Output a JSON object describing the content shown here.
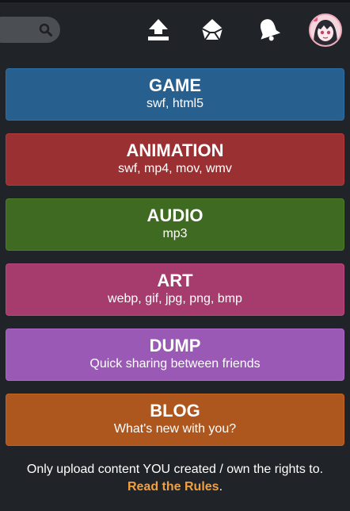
{
  "topbar": {
    "search_placeholder": "",
    "icons": [
      "search-icon",
      "upload-icon",
      "envelope-icon",
      "bell-icon",
      "avatar"
    ]
  },
  "categories": [
    {
      "title": "GAME",
      "formats": "swf, html5",
      "color": "#275f8f",
      "border": "#2d6ea5"
    },
    {
      "title": "ANIMATION",
      "formats": "swf, mp4, mov, wmv",
      "color": "#9a3032",
      "border": "#b23a3c"
    },
    {
      "title": "AUDIO",
      "formats": "mp3",
      "color": "#3f6a21",
      "border": "#4b7c28"
    },
    {
      "title": "ART",
      "formats": "webp, gif, jpg, png, bmp",
      "color": "#a63c6e",
      "border": "#bd4780"
    },
    {
      "title": "DUMP",
      "formats": "Quick sharing between friends",
      "color": "#9a59b4",
      "border": "#aa66c4"
    },
    {
      "title": "BLOG",
      "formats": "What's new with you?",
      "color": "#ad561d",
      "border": "#c4631f"
    }
  ],
  "footer": {
    "notice": "Only upload content YOU created / own the rights to.",
    "rules_link": "Read the Rules",
    "period": "."
  }
}
